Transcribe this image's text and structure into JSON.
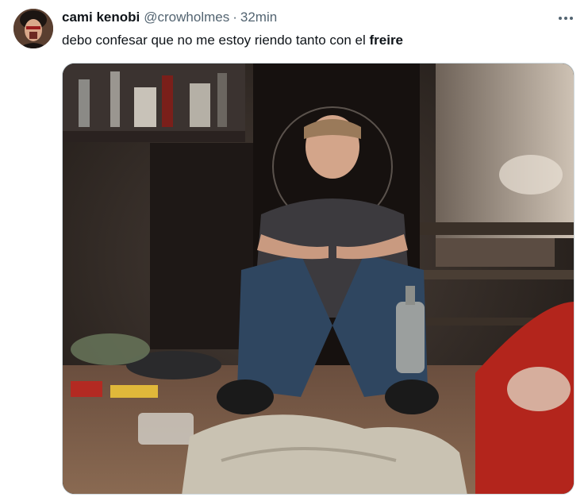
{
  "tweet": {
    "display_name": "cami kenobi",
    "handle": "@crowholmes",
    "separator": "·",
    "time": "32min",
    "text_prefix": "debo confesar que no me estoy riendo tanto con el ",
    "text_bold": "freire"
  },
  "icons": {
    "more": "more-horizontal-icon"
  },
  "colors": {
    "text_primary": "#0f1419",
    "text_secondary": "#536471",
    "border": "#cfd9de"
  }
}
